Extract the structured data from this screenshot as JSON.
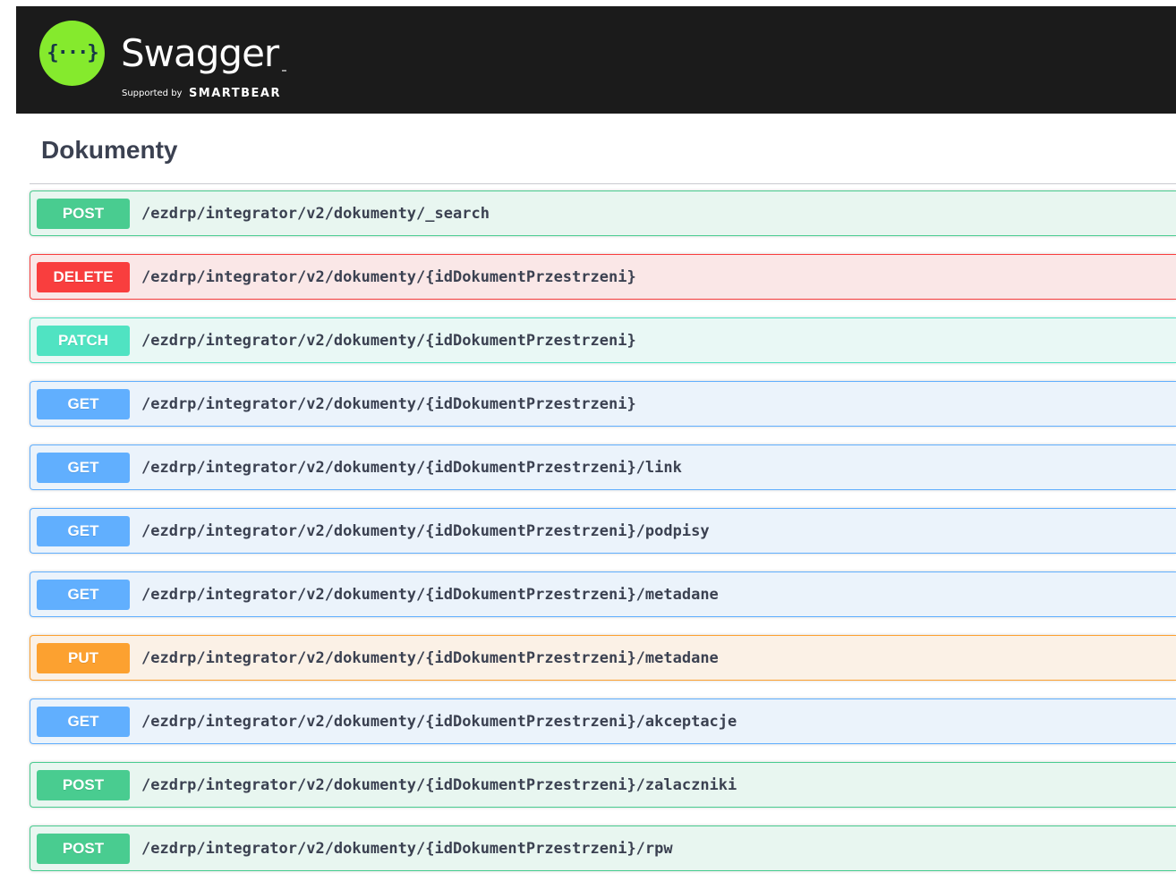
{
  "header": {
    "brand_name": "Swagger",
    "logo_glyph": "{···}",
    "supported_by": "Supported by",
    "company": "SMARTBEAR"
  },
  "section": {
    "title": "Dokumenty"
  },
  "operations": [
    {
      "method": "POST",
      "path": "/ezdrp/integrator/v2/dokumenty/_search"
    },
    {
      "method": "DELETE",
      "path": "/ezdrp/integrator/v2/dokumenty/{idDokumentPrzestrzeni}"
    },
    {
      "method": "PATCH",
      "path": "/ezdrp/integrator/v2/dokumenty/{idDokumentPrzestrzeni}"
    },
    {
      "method": "GET",
      "path": "/ezdrp/integrator/v2/dokumenty/{idDokumentPrzestrzeni}"
    },
    {
      "method": "GET",
      "path": "/ezdrp/integrator/v2/dokumenty/{idDokumentPrzestrzeni}/link"
    },
    {
      "method": "GET",
      "path": "/ezdrp/integrator/v2/dokumenty/{idDokumentPrzestrzeni}/podpisy"
    },
    {
      "method": "GET",
      "path": "/ezdrp/integrator/v2/dokumenty/{idDokumentPrzestrzeni}/metadane"
    },
    {
      "method": "PUT",
      "path": "/ezdrp/integrator/v2/dokumenty/{idDokumentPrzestrzeni}/metadane"
    },
    {
      "method": "GET",
      "path": "/ezdrp/integrator/v2/dokumenty/{idDokumentPrzestrzeni}/akceptacje"
    },
    {
      "method": "POST",
      "path": "/ezdrp/integrator/v2/dokumenty/{idDokumentPrzestrzeni}/zalaczniki"
    },
    {
      "method": "POST",
      "path": "/ezdrp/integrator/v2/dokumenty/{idDokumentPrzestrzeni}/rpw"
    }
  ],
  "colors": {
    "topbar": "#1b1b1b",
    "logo": "#85ea2d",
    "post": "#49cc90",
    "delete": "#f93e3e",
    "patch": "#50e3c2",
    "get": "#61affe",
    "put": "#fca130",
    "text": "#3b4151"
  }
}
